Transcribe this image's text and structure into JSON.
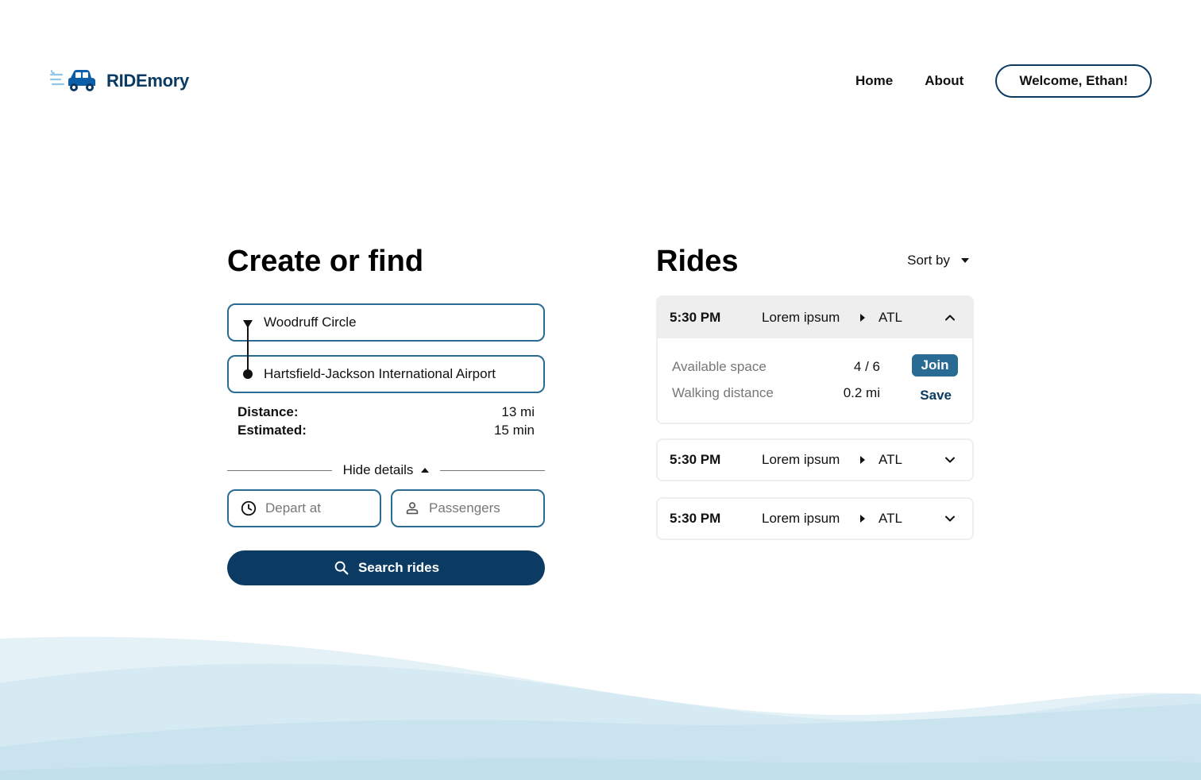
{
  "brand": {
    "name": "RIDEmory",
    "logo_icon": "car-icon",
    "accent": "#0b3a63",
    "secondary": "#2a6b93"
  },
  "nav": {
    "home": "Home",
    "about": "About",
    "welcome": "Welcome, Ethan!"
  },
  "create": {
    "title": "Create or find",
    "from": "Woodruff Circle",
    "to": "Hartsfield-Jackson International Airport",
    "distance_label": "Distance:",
    "distance_value": "13 mi",
    "estimated_label": "Estimated:",
    "estimated_value": "15 min",
    "hide_details": "Hide details",
    "depart_placeholder": "Depart at",
    "passengers_placeholder": "Passengers",
    "search_label": "Search rides"
  },
  "rides": {
    "title": "Rides",
    "sort_label": "Sort by",
    "items": [
      {
        "time": "5:30 PM",
        "from": "Lorem ipsum",
        "to": "ATL",
        "expanded": true,
        "space_label": "Available space",
        "space_value": "4 / 6",
        "walk_label": "Walking distance",
        "walk_value": "0.2 mi",
        "join": "Join",
        "save": "Save"
      },
      {
        "time": "5:30 PM",
        "from": "Lorem ipsum",
        "to": "ATL",
        "expanded": false
      },
      {
        "time": "5:30 PM",
        "from": "Lorem ipsum",
        "to": "ATL",
        "expanded": false
      }
    ]
  }
}
